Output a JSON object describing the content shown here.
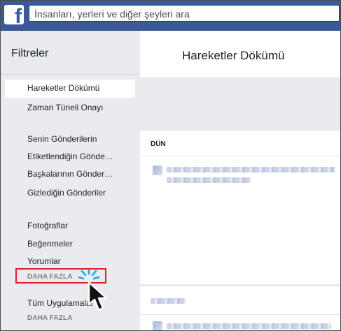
{
  "topbar": {
    "logo_letter": "f",
    "search_placeholder": "İnsanları, yerleri ve diğer şeyleri ara"
  },
  "sidebar": {
    "title": "Filtreler",
    "items": [
      {
        "label": "Hareketler Dökümü",
        "active": true
      },
      {
        "label": "Zaman Tüneli Onayı"
      },
      {
        "label": "Senin Gönderilerin"
      },
      {
        "label": "Etiketlendiğin Gönde…"
      },
      {
        "label": "Başkalarının Gönder…"
      },
      {
        "label": "Gizlediğin Gönderiler"
      },
      {
        "label": "Fotoğraflar"
      },
      {
        "label": "Beğenmeler"
      },
      {
        "label": "Yorumlar"
      },
      {
        "label": "Tüm Uygulamalar"
      }
    ],
    "more_label_1": "DAHA FAZLA",
    "more_label_2": "DAHA FAZLA"
  },
  "main": {
    "title": "Hareketler Dökümü",
    "section_yesterday": "DÜN"
  },
  "colors": {
    "brand_blue": "#3b5998",
    "highlight_red": "#e41e26",
    "spark_blue": "#1aa7e5"
  }
}
